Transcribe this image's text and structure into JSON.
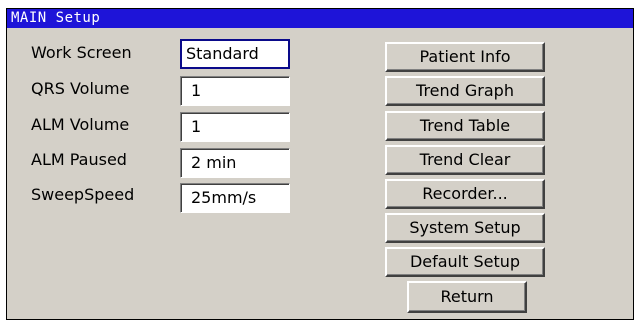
{
  "window": {
    "title": "MAIN Setup"
  },
  "fields": [
    {
      "label": "Work Screen",
      "value": "Standard"
    },
    {
      "label": "QRS Volume",
      "value": "1"
    },
    {
      "label": "ALM Volume",
      "value": "1"
    },
    {
      "label": "ALM Paused",
      "value": "2 min"
    },
    {
      "label": "SweepSpeed",
      "value": "25mm/s"
    }
  ],
  "buttons": {
    "patient_info": "Patient Info",
    "trend_graph": "Trend Graph",
    "trend_table": "Trend Table",
    "trend_clear": "Trend Clear",
    "recorder": "Recorder...",
    "system_setup": "System Setup",
    "default_setup": "Default Setup",
    "return": "Return"
  },
  "colors": {
    "title_bar": "#1e14d8",
    "dialog_bg": "#d4d0c8",
    "focus_border": "#0a0a8a"
  }
}
